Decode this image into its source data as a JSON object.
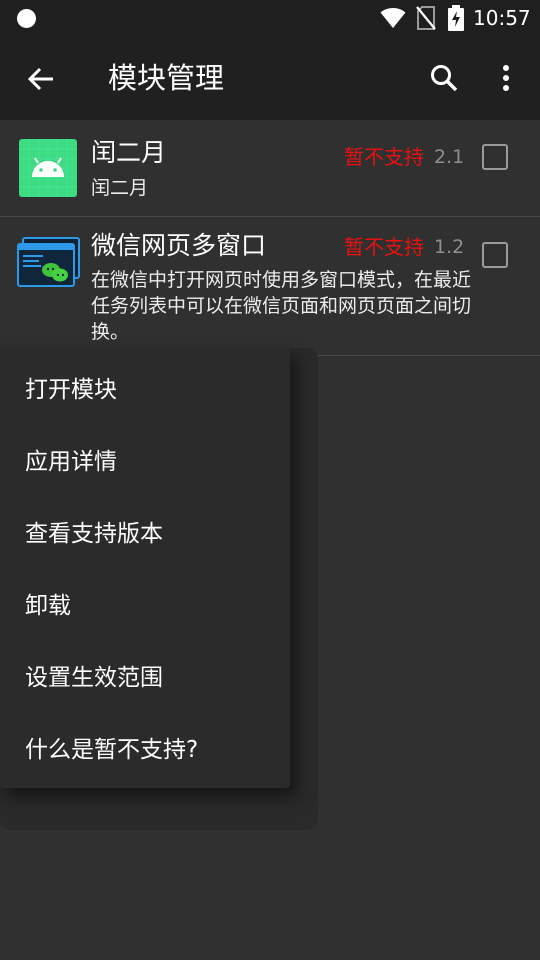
{
  "status_bar": {
    "time": "10:57",
    "icons": [
      "notification-dot-icon",
      "wifi-icon",
      "no-sim-icon",
      "battery-charging-icon"
    ]
  },
  "app_bar": {
    "title": "模块管理",
    "back_icon": "arrow-back-icon",
    "search_icon": "search-icon",
    "more_icon": "more-vert-icon"
  },
  "modules": [
    {
      "name": "闰二月",
      "description": "闰二月",
      "status": "暂不支持",
      "version": "2.1",
      "enabled": false,
      "icon": "android-icon"
    },
    {
      "name": "微信网页多窗口",
      "description": "在微信中打开网页时使用多窗口模式，在最近任务列表中可以在微信页面和网页页面之间切换。",
      "status": "暂不支持",
      "version": "1.2",
      "enabled": false,
      "icon": "wechat-window-icon"
    }
  ],
  "context_menu": {
    "items": [
      "打开模块",
      "应用详情",
      "查看支持版本",
      "卸载",
      "设置生效范围",
      "什么是暂不支持?"
    ]
  },
  "colors": {
    "background": "#303030",
    "app_bar": "#202020",
    "status_bar": "#1f1f1f",
    "unsupported": "#e8110f",
    "version": "#8f8f8f",
    "menu": "#2b2b2b"
  }
}
